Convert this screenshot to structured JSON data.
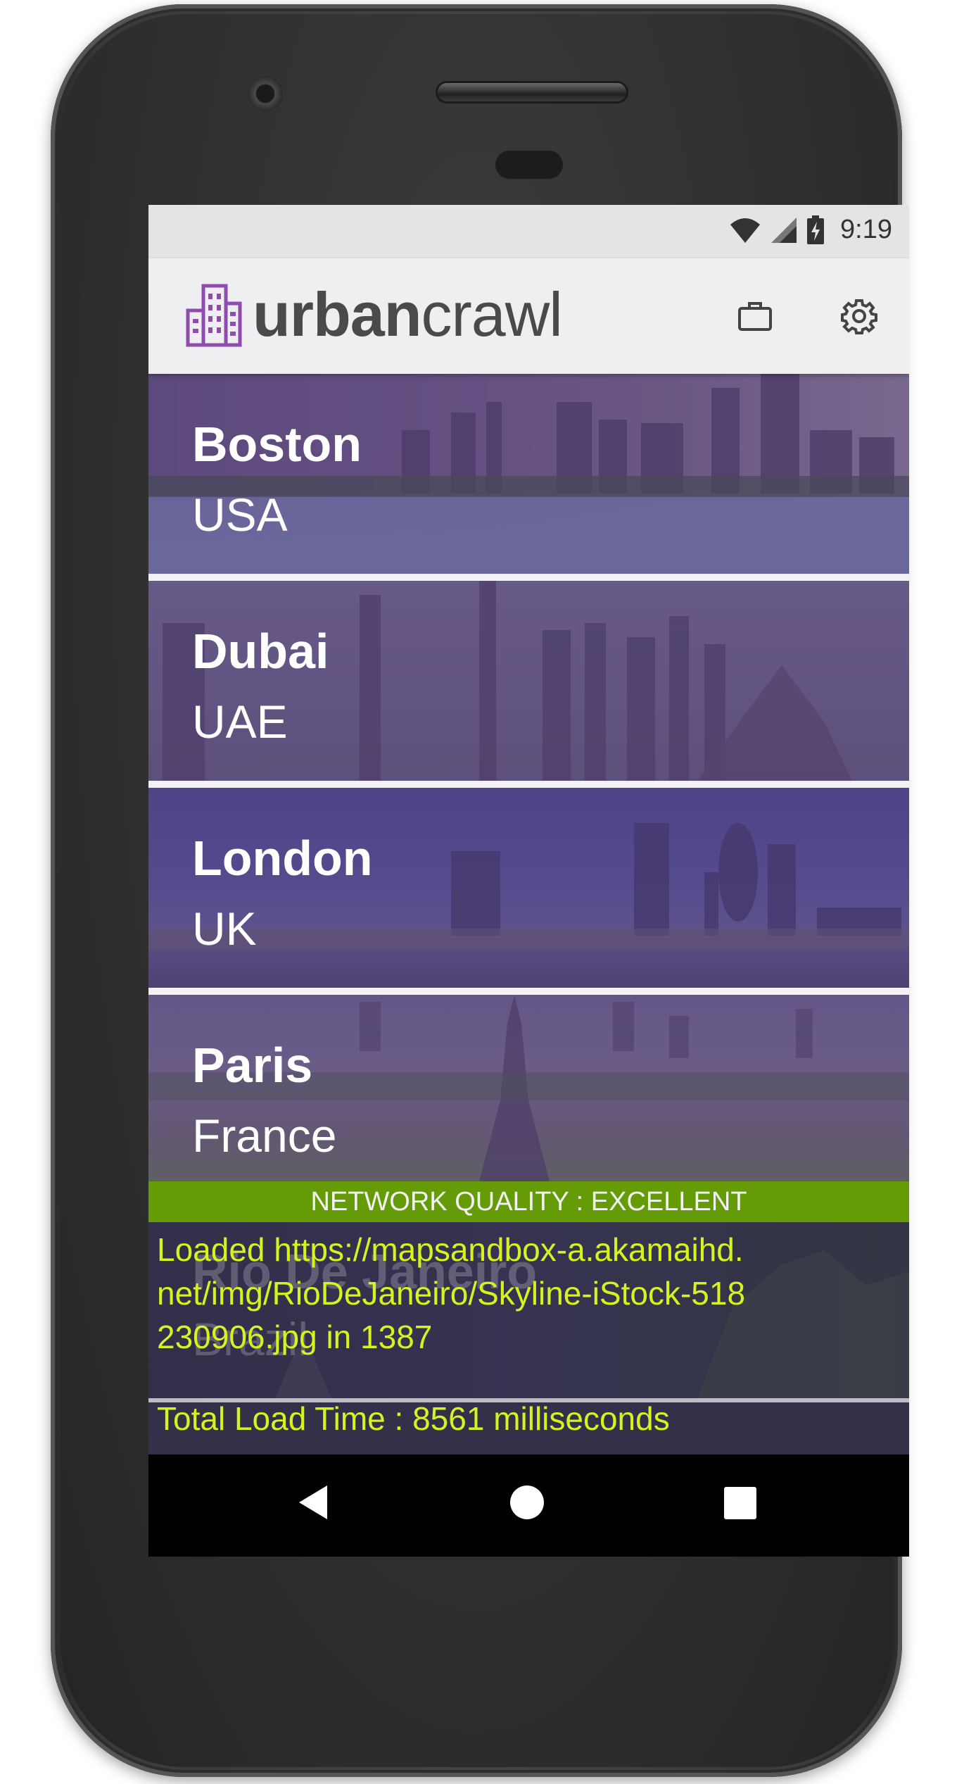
{
  "status_bar": {
    "time": "9:19",
    "icons": [
      "wifi-icon",
      "cellular-signal-icon",
      "battery-charging-icon"
    ]
  },
  "app_bar": {
    "logo_bold": "urban",
    "logo_light": "crawl",
    "actions": [
      "briefcase-icon",
      "gear-icon"
    ]
  },
  "cities": [
    {
      "name": "Boston",
      "country": "USA"
    },
    {
      "name": "Dubai",
      "country": "UAE"
    },
    {
      "name": "London",
      "country": "UK"
    },
    {
      "name": "Paris",
      "country": "France"
    },
    {
      "name": "Rio De Janeiro",
      "country": "Brazil"
    }
  ],
  "network": {
    "quality_text": "NETWORK QUALITY : EXCELLENT",
    "color": "#659b06"
  },
  "log": {
    "loaded_text": "Loaded https://mapsandbox-a.akamaihd.net/img/RioDeJaneiro/Skyline-iStock-518230906.jpg in 1387",
    "total_text": "Total Load Time : 8561 milliseconds",
    "text_color": "#d7f21e"
  },
  "nav_bar": {
    "buttons": [
      "back-icon",
      "home-icon",
      "recents-icon"
    ]
  }
}
